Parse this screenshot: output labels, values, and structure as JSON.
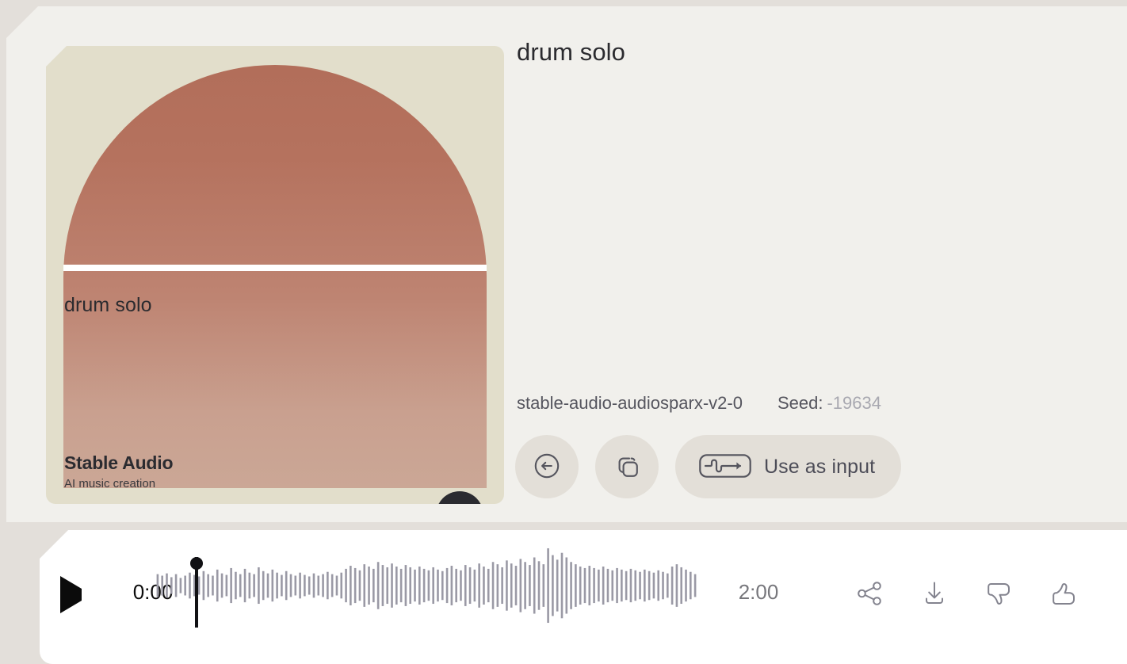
{
  "theme": {
    "page_background": "#E3DFDA",
    "panel_background": "#F1F0EC",
    "card_background": "#E2DECB",
    "player_background": "#FFFFFF",
    "accent_artwork_top": "#B26E5A",
    "accent_artwork_bottom": "#CBA796",
    "button_background": "#E3DFD8",
    "icon_stroke": "#55555E",
    "waveform_color": "#9A99A5",
    "playhead_color": "#111114"
  },
  "track": {
    "title": "drum solo"
  },
  "album_card": {
    "title": "drum solo",
    "brand_name": "Stable Audio",
    "brand_tagline": "AI music creation",
    "logo_icon": "stable-audio-dome-logo"
  },
  "meta": {
    "model": "stable-audio-audiosparx-v2-0",
    "seed_label": "Seed:",
    "seed_value": "-19634"
  },
  "actions": [
    {
      "name": "revert-button",
      "icon": "arrow-left-circle-icon",
      "label": ""
    },
    {
      "name": "copy-button",
      "icon": "copy-icon",
      "label": ""
    },
    {
      "name": "use-as-input-button",
      "icon": "waveform-arrow-icon",
      "label": "Use as input"
    }
  ],
  "player": {
    "play_icon": "play-icon",
    "current_time": "0:00",
    "total_time": "2:00",
    "playhead_position_percent": 0,
    "waveform": {
      "bar_count": 118,
      "amplitudes": [
        0.3,
        0.26,
        0.32,
        0.22,
        0.3,
        0.2,
        0.26,
        0.34,
        0.28,
        0.24,
        0.38,
        0.3,
        0.26,
        0.42,
        0.32,
        0.28,
        0.46,
        0.36,
        0.3,
        0.44,
        0.34,
        0.3,
        0.48,
        0.38,
        0.32,
        0.42,
        0.34,
        0.28,
        0.38,
        0.3,
        0.26,
        0.34,
        0.28,
        0.24,
        0.32,
        0.26,
        0.3,
        0.36,
        0.3,
        0.26,
        0.34,
        0.44,
        0.52,
        0.46,
        0.4,
        0.56,
        0.5,
        0.44,
        0.62,
        0.54,
        0.48,
        0.58,
        0.5,
        0.44,
        0.54,
        0.48,
        0.42,
        0.5,
        0.44,
        0.4,
        0.48,
        0.42,
        0.38,
        0.46,
        0.52,
        0.44,
        0.4,
        0.54,
        0.48,
        0.42,
        0.58,
        0.5,
        0.44,
        0.62,
        0.56,
        0.48,
        0.66,
        0.58,
        0.52,
        0.7,
        0.62,
        0.54,
        0.74,
        0.64,
        0.56,
        0.98,
        0.8,
        0.68,
        0.86,
        0.74,
        0.62,
        0.56,
        0.5,
        0.46,
        0.52,
        0.46,
        0.42,
        0.5,
        0.44,
        0.4,
        0.46,
        0.42,
        0.38,
        0.44,
        0.4,
        0.36,
        0.42,
        0.38,
        0.34,
        0.4,
        0.36,
        0.32,
        0.5,
        0.56,
        0.48,
        0.42,
        0.36,
        0.3
      ]
    },
    "actions": [
      {
        "name": "share-button",
        "icon": "share-icon"
      },
      {
        "name": "download-button",
        "icon": "download-icon"
      },
      {
        "name": "dislike-button",
        "icon": "thumbs-down-icon"
      },
      {
        "name": "like-button",
        "icon": "thumbs-up-icon"
      }
    ]
  }
}
